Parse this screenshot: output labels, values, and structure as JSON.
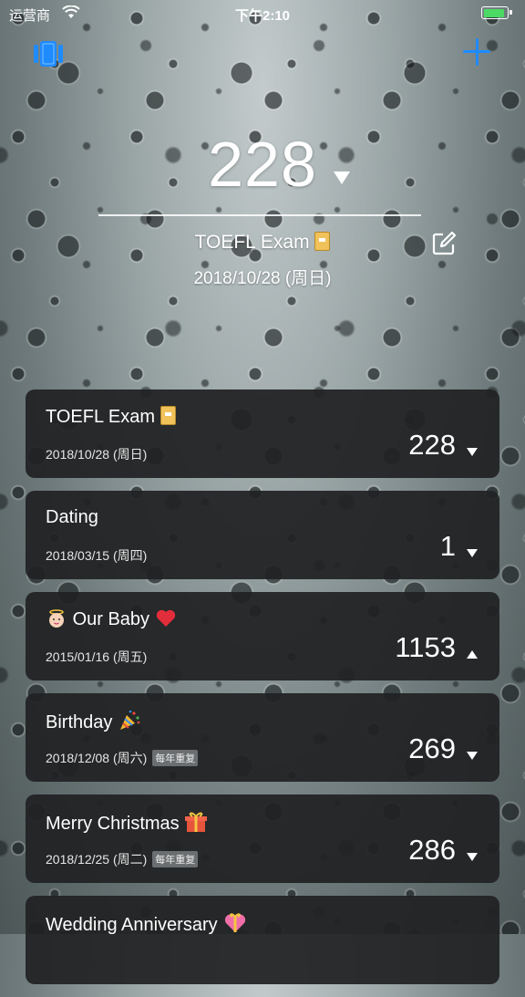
{
  "status_bar": {
    "carrier": "运营商",
    "time": "下午2:10"
  },
  "colors": {
    "accent": "#1e8bff",
    "card_bg": "#202122",
    "battery": "#4cd964"
  },
  "hero": {
    "count": "228",
    "direction": "down",
    "title": "TOEFL Exam",
    "title_icon": "book-icon",
    "date": "2018/10/28 (周日)"
  },
  "events": [
    {
      "title": "TOEFL Exam",
      "icon": "book-icon",
      "date": "2018/10/28 (周日)",
      "badge": "",
      "count": "228",
      "direction": "down"
    },
    {
      "title": "Dating",
      "icon": "",
      "date": "2018/03/15 (周四)",
      "badge": "",
      "count": "1",
      "direction": "down"
    },
    {
      "title": "Our Baby",
      "icon": "baby-heart-icon",
      "date": "2015/01/16 (周五)",
      "badge": "",
      "count": "1153",
      "direction": "up"
    },
    {
      "title": "Birthday",
      "icon": "party-icon",
      "date": "2018/12/08 (周六)",
      "badge": "每年重复",
      "count": "269",
      "direction": "down"
    },
    {
      "title": "Merry Christmas",
      "icon": "gift-icon",
      "date": "2018/12/25 (周二)",
      "badge": "每年重复",
      "count": "286",
      "direction": "down"
    },
    {
      "title": "Wedding Anniversary",
      "icon": "heart-gift-icon",
      "date": "",
      "badge": "",
      "count": "",
      "direction": "down"
    }
  ]
}
